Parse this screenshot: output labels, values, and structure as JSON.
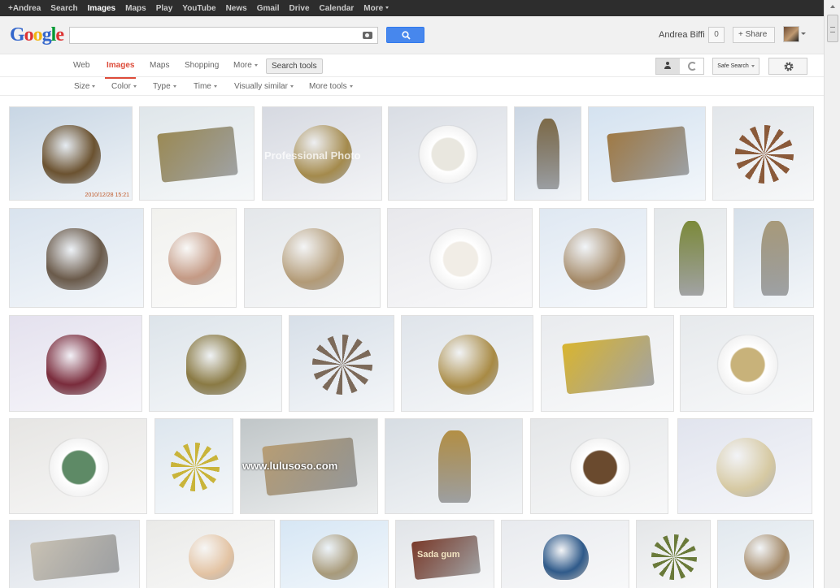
{
  "gbar": {
    "items": [
      "+Andrea",
      "Search",
      "Images",
      "Maps",
      "Play",
      "YouTube",
      "News",
      "Gmail",
      "Drive",
      "Calendar",
      "More"
    ]
  },
  "header": {
    "logo_letters": [
      "G",
      "o",
      "o",
      "g",
      "l",
      "e"
    ],
    "logo_colors": [
      "#3366cc",
      "#dd3333",
      "#f2b50f",
      "#3366cc",
      "#009933",
      "#dd3333"
    ],
    "search_value": "",
    "user_name": "Andrea Biffi",
    "notification_count": "0",
    "share_label": "Share",
    "share_prefix": "+"
  },
  "nav": {
    "tabs": [
      "Web",
      "Images",
      "Maps",
      "Shopping",
      "More"
    ],
    "active_tab": "Images",
    "search_tools_label": "Search tools",
    "safe_search_label": "Safe Search"
  },
  "filters": {
    "items": [
      "Size",
      "Color",
      "Type",
      "Time",
      "Visually similar",
      "More tools"
    ]
  },
  "images": {
    "overlay_texts": [
      "Professional Photo",
      "www.lulusoso.com",
      "Sada gum",
      "2010/12/28 15:21"
    ],
    "subjects": [
      "truffles",
      "motor",
      "soccer-ball",
      "food-bowl",
      "figurine",
      "cake",
      "starfish-dish",
      "puppy",
      "man-portrait",
      "coffee-cup",
      "plated-dessert",
      "sloth-toy",
      "shrek-figure",
      "samovar",
      "cupcake",
      "brass-buttons",
      "tiny-planet",
      "pendant",
      "motorcycle",
      "noodles",
      "salad-bowl",
      "flower-sculpture",
      "gift-box",
      "brass-stand",
      "candle-dish",
      "compact-powder",
      "sushi-plate",
      "doll-face",
      "ring",
      "candy-box",
      "ceramic-bird",
      "skewer",
      "sloth-toy-2"
    ]
  },
  "colors": {
    "accent": "#dd4b39",
    "search_button": "#4787ed",
    "gbar_bg": "#2d2d2d"
  }
}
